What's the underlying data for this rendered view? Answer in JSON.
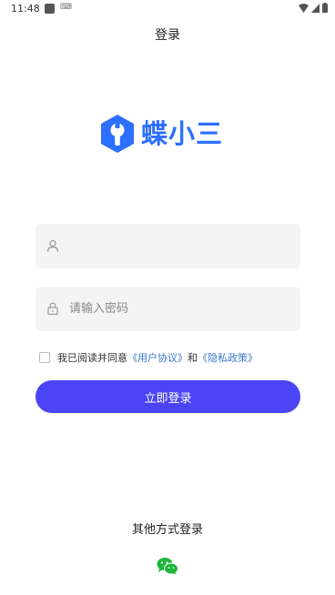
{
  "status": {
    "time": "11:48",
    "kb": "⌨"
  },
  "header": {
    "title": "登录"
  },
  "logo": {
    "text": "蝶小三"
  },
  "form": {
    "username": {
      "value": "",
      "placeholder": ""
    },
    "password": {
      "value": "",
      "placeholder": "请输入密码"
    }
  },
  "agreement": {
    "prefix": "我已阅读并同意",
    "user_agreement": "《用户协议》",
    "and": "和",
    "privacy_policy": "《隐私政策》"
  },
  "login_button": {
    "label": "立即登录"
  },
  "other_login": {
    "title": "其他方式登录"
  },
  "colors": {
    "accent": "#4b44f5",
    "link": "#3a78c9",
    "logo": "#2d6fff",
    "wechat": "#20b53a"
  },
  "icons": {
    "username": "user-icon",
    "password": "lock-icon",
    "social": "wechat-icon"
  }
}
